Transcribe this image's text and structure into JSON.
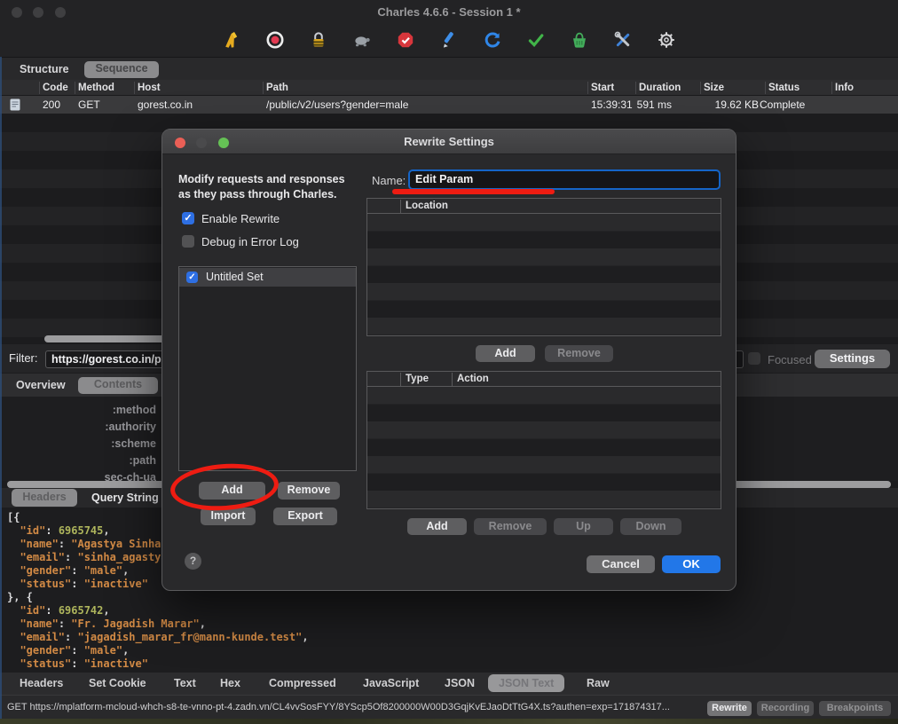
{
  "window": {
    "title": "Charles 4.6.6 - Session 1 *"
  },
  "toolbar": {
    "icons": [
      "broom-icon",
      "record-icon",
      "ssl-lock-icon",
      "throttle-turtle-icon",
      "breakpoints-icon",
      "compose-pencil-icon",
      "repeat-icon",
      "validate-check-icon",
      "publish-basket-icon",
      "tools-icon",
      "settings-gear-icon"
    ]
  },
  "main_tabs": {
    "structure": "Structure",
    "sequence": "Sequence"
  },
  "table": {
    "columns": [
      "Code",
      "Method",
      "Host",
      "Path",
      "Start",
      "Duration",
      "Size",
      "Status",
      "Info"
    ],
    "row": {
      "code": "200",
      "method": "GET",
      "host": "gorest.co.in",
      "path": "/public/v2/users?gender=male",
      "start": "15:39:31",
      "duration": "591 ms",
      "size": "19.62 KB",
      "status": "Complete"
    }
  },
  "filter": {
    "label": "Filter:",
    "value": "https://gorest.co.in/p",
    "focused_label": "Focused",
    "settings_label": "Settings"
  },
  "view_tabs": {
    "overview": "Overview",
    "contents": "Contents"
  },
  "request_headers": [
    ":method",
    ":authority",
    ":scheme",
    ":path",
    "sec-ch-ua"
  ],
  "request_tabs": {
    "headers": "Headers",
    "query_string": "Query String"
  },
  "response_json_lines": [
    "[{",
    "  \"id\": 6965745,",
    "  \"name\": \"Agastya Sinha\"",
    "  \"email\": \"sinha_agastya",
    "  \"gender\": \"male\",",
    "  \"status\": \"inactive\"",
    "}, {",
    "  \"id\": 6965742,",
    "  \"name\": \"Fr. Jagadish Marar\",",
    "  \"email\": \"jagadish_marar_fr@mann-kunde.test\",",
    "  \"gender\": \"male\",",
    "  \"status\": \"inactive\"",
    "}, {"
  ],
  "response_tabs": {
    "items": [
      "Headers",
      "Set Cookie",
      "Text",
      "Hex",
      "Compressed",
      "JavaScript",
      "JSON",
      "JSON Text",
      "Raw"
    ],
    "selected": "JSON Text"
  },
  "status_bar": {
    "text": "GET https://mplatform-mcloud-whch-s8-te-vnno-pt-4.zadn.vn/CL4vvSosFYY/8YScp5Of8200000W00D3GqjKvEJaoDtTtG4X.ts?authen=exp=171874317...",
    "buttons": [
      "Rewrite",
      "Recording",
      "Breakpoints"
    ]
  },
  "dialog": {
    "title": "Rewrite Settings",
    "description_line1": "Modify requests and responses",
    "description_line2": "as they pass through Charles.",
    "enable_rewrite_label": "Enable Rewrite",
    "debug_label": "Debug in Error Log",
    "set_item_label": "Untitled Set",
    "buttons": {
      "add": "Add",
      "remove": "Remove",
      "import": "Import",
      "export": "Export",
      "up": "Up",
      "down": "Down",
      "cancel": "Cancel",
      "ok": "OK",
      "help": "?"
    },
    "name_label": "Name:",
    "name_value": "Edit Param",
    "location_header": "Location",
    "rule_headers": {
      "type": "Type",
      "action": "Action"
    }
  },
  "colors": {
    "accent_blue": "#2277e8",
    "checkbox_blue": "#2e6fe3",
    "annotation_red": "#ee1c12",
    "selected_pill": "#8b8b8d"
  }
}
